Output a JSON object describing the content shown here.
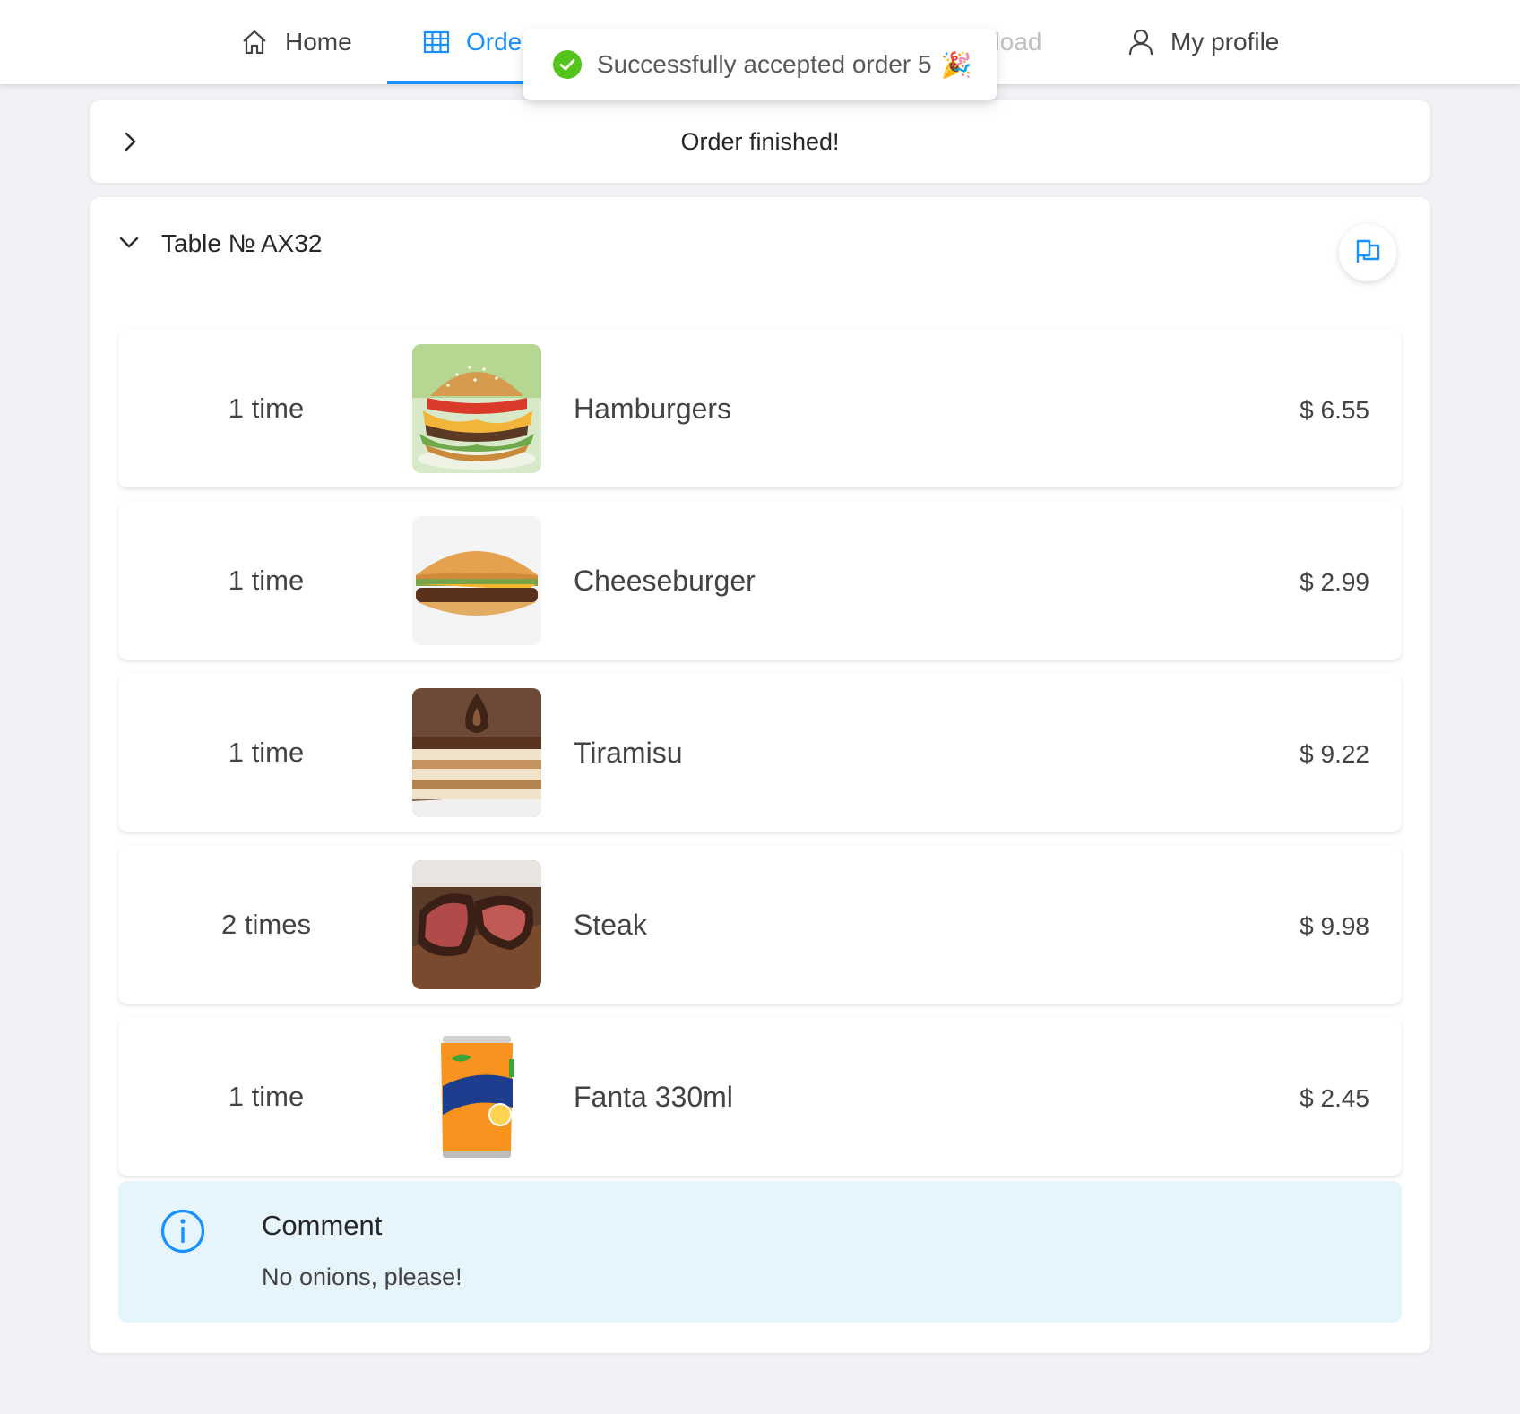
{
  "nav": {
    "home": "Home",
    "orders": "Orde",
    "load": "t load",
    "profile": "My profile"
  },
  "toast": {
    "message": "Successfully accepted order 5",
    "emoji": "🎉"
  },
  "finished": {
    "title": "Order finished!"
  },
  "table": {
    "title": "Table № AX32",
    "items": [
      {
        "qty": "1 time",
        "name": "Hamburgers",
        "price": "$ 6.55",
        "image": "hamburger"
      },
      {
        "qty": "1 time",
        "name": "Cheeseburger",
        "price": "$ 2.99",
        "image": "cheeseburger"
      },
      {
        "qty": "1 time",
        "name": "Tiramisu",
        "price": "$ 9.22",
        "image": "tiramisu"
      },
      {
        "qty": "2 times",
        "name": "Steak",
        "price": "$ 9.98",
        "image": "steak"
      },
      {
        "qty": "1 time",
        "name": "Fanta 330ml",
        "price": "$ 2.45",
        "image": "fanta-can"
      }
    ],
    "comment": {
      "title": "Comment",
      "text": "No onions, please!"
    }
  },
  "colors": {
    "accent": "#1890ff",
    "success": "#52c41a",
    "comment_bg": "#e6f4fc"
  }
}
